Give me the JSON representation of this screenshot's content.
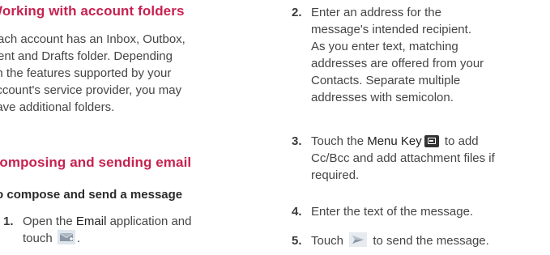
{
  "left": {
    "section1_heading": "Working with account folders",
    "section1_lines": [
      "Each account has an Inbox, Outbox,",
      "Sent and Drafts folder. Depending",
      "on the features supported by your",
      "account's service provider, you may",
      "have additional folders."
    ],
    "section2_heading": "Composing and sending email",
    "subheading": "To compose and send a message",
    "step1": {
      "num": "1.",
      "line1_pre": "Open the ",
      "line1_kw": "Email",
      "line1_post": " application and",
      "line2_pre": "touch ",
      "line2_post": ".",
      "icon": "compose-email-icon"
    }
  },
  "right": {
    "step2": {
      "num": "2.",
      "lines": [
        "Enter an address for the",
        "message's intended recipient.",
        "As you enter text, matching",
        "addresses are offered from your",
        "Contacts. Separate multiple",
        "addresses with semicolon."
      ]
    },
    "step3": {
      "num": "3.",
      "line1_pre": "Touch the ",
      "line1_kw": "Menu Key",
      "line1_post": " to add",
      "line2": "Cc/Bcc and add attachment files if",
      "line3": "required.",
      "icon": "menu-key-icon"
    },
    "step4": {
      "num": "4.",
      "text": "Enter the text of the message."
    },
    "step5": {
      "num": "5.",
      "pre": "Touch ",
      "post": " to send the message.",
      "icon": "send-icon"
    }
  },
  "colors": {
    "heading": "#c6224f",
    "body": "#454545"
  }
}
